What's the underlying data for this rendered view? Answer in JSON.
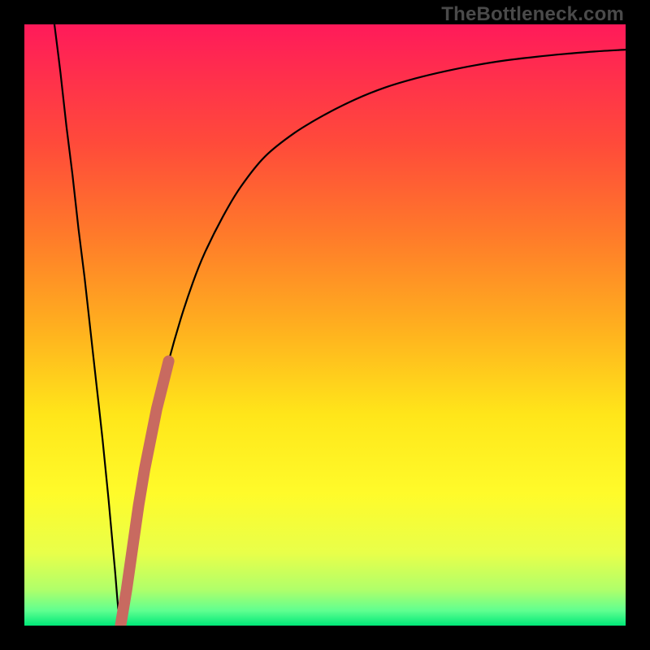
{
  "watermark": "TheBottleneck.com",
  "colors": {
    "frame": "#000000",
    "curve": "#000000",
    "highlight": "#c86a60",
    "gradient_stops": [
      {
        "offset": 0.0,
        "color": "#ff1a5a"
      },
      {
        "offset": 0.08,
        "color": "#ff2e4d"
      },
      {
        "offset": 0.2,
        "color": "#ff4b3a"
      },
      {
        "offset": 0.35,
        "color": "#ff7a2a"
      },
      {
        "offset": 0.5,
        "color": "#ffae1f"
      },
      {
        "offset": 0.65,
        "color": "#ffe61a"
      },
      {
        "offset": 0.78,
        "color": "#fffb2a"
      },
      {
        "offset": 0.88,
        "color": "#e8ff4a"
      },
      {
        "offset": 0.94,
        "color": "#b0ff6a"
      },
      {
        "offset": 0.975,
        "color": "#60ff90"
      },
      {
        "offset": 1.0,
        "color": "#00e878"
      }
    ]
  },
  "chart_data": {
    "type": "line",
    "title": "",
    "xlabel": "",
    "ylabel": "",
    "xlim": [
      0,
      100
    ],
    "ylim": [
      0,
      100
    ],
    "series": [
      {
        "name": "bottleneck-curve",
        "x": [
          5,
          6,
          7,
          8,
          9,
          10,
          11,
          12,
          13,
          14,
          15,
          16,
          17,
          18,
          19,
          20,
          22,
          24,
          26,
          28,
          30,
          33,
          36,
          40,
          45,
          50,
          55,
          60,
          65,
          70,
          75,
          80,
          85,
          90,
          95,
          100
        ],
        "y": [
          100,
          92,
          83,
          75,
          66,
          58,
          49,
          40,
          31,
          21,
          10,
          0,
          6,
          13,
          20,
          26,
          36,
          44,
          51,
          57,
          62,
          68,
          73,
          78,
          82,
          85,
          87.5,
          89.5,
          91,
          92.2,
          93.2,
          94,
          94.6,
          95.1,
          95.5,
          95.8
        ]
      },
      {
        "name": "highlight-segment",
        "x": [
          16,
          17,
          18,
          19,
          20,
          21,
          22,
          23,
          24
        ],
        "y": [
          0,
          6,
          13,
          20,
          26,
          31,
          36,
          40,
          44
        ]
      }
    ],
    "minimum_point": {
      "x": 16,
      "y": 0
    }
  }
}
